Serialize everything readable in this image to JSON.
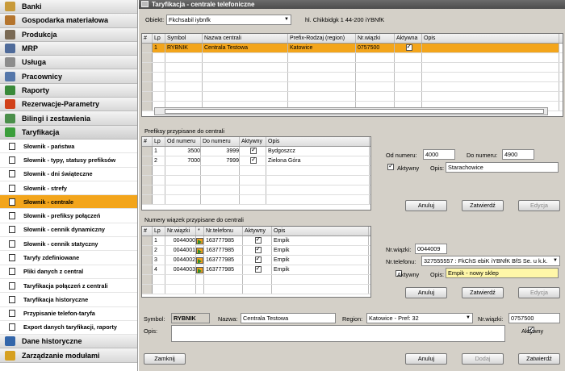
{
  "sidebar": {
    "modules_top": [
      {
        "label": "Banki",
        "icon": "bank-icon",
        "color": "#c89a3a"
      },
      {
        "label": "Gospodarka materiałowa",
        "icon": "boxes-icon",
        "color": "#b5752e"
      },
      {
        "label": "Produkcja",
        "icon": "gears-icon",
        "color": "#7a6a55"
      },
      {
        "label": "MRP",
        "icon": "mrp-icon",
        "color": "#4f6b9a"
      },
      {
        "label": "Usługa",
        "icon": "tools-icon",
        "color": "#8c8c8c"
      },
      {
        "label": "Pracownicy",
        "icon": "people-icon",
        "color": "#5577aa"
      },
      {
        "label": "Raporty",
        "icon": "report-icon",
        "color": "#3a8a3a"
      },
      {
        "label": "Rezerwacje-Parametry",
        "icon": "reservation-icon",
        "color": "#d1411a"
      },
      {
        "label": "Bilingi i zestawienia",
        "icon": "billing-icon",
        "color": "#4a8f4a"
      },
      {
        "label": "Taryfikacja",
        "icon": "tariff-icon",
        "color": "#3b9e3b"
      }
    ],
    "subitems": [
      "Słownik - państwa",
      "Słownik - typy, statusy prefiksów",
      "Słownik - dni świąteczne",
      "Słownik - strefy",
      "Słownik - centrale",
      "Słownik - prefiksy połączeń",
      "Słownik - cennik dynamiczny",
      "Słownik - cennik statyczny",
      "Taryfy zdefiniowane",
      "Pliki danych z central",
      "Taryfikacja połączeń z centrali",
      "Taryfikacja historyczne",
      "Przypisanie telefon-taryfa",
      "Export danych taryfikacji, raporty"
    ],
    "active_sub_index": 4,
    "modules_bottom": [
      {
        "label": "Dane historyczne",
        "icon": "history-icon",
        "color": "#3366aa"
      },
      {
        "label": "Zarządzanie modułami",
        "icon": "key-icon",
        "color": "#d6a020"
      }
    ]
  },
  "window": {
    "title": "Taryfikacja - centrale telefoniczne"
  },
  "top": {
    "obiekt_label": "Obiekt:",
    "obiekt_value": "Fkchsabil iybnfk",
    "address": "hl. Chikbidgk 1 44-200 iYBNfK"
  },
  "centrale_grid": {
    "headers": [
      "#",
      "Lp",
      "Symbol",
      "Nazwa centrali",
      "Prefix-Rodzaj (region)",
      "Nr.wiązki",
      "Aktywna",
      "Opis"
    ],
    "rows": [
      {
        "lp": "1",
        "symbol": "RYBNIK",
        "nazwa": "Centrala Testowa",
        "prefix": "Katowice",
        "wiazka": "0757500",
        "aktywna": true,
        "opis": ""
      }
    ]
  },
  "prefiksy": {
    "section_label": "Prefiksy przypisane do centrali",
    "headers": [
      "#",
      "Lp",
      "Od numeru",
      "Do numeru",
      "Aktywny",
      "Opis"
    ],
    "rows": [
      {
        "lp": "1",
        "od": "3500",
        "do": "3999",
        "aktywny": true,
        "opis": "Bydgoszcz"
      },
      {
        "lp": "2",
        "od": "7000",
        "do": "7999",
        "aktywny": true,
        "opis": "Zielona Góra"
      }
    ],
    "form": {
      "od_label": "Od numeru:",
      "od_value": "4000",
      "do_label": "Do numeru:",
      "do_value": "4900",
      "aktywny_label": "Aktywny",
      "aktywny": true,
      "opis_label": "Opis:",
      "opis_value": "Starachowice"
    },
    "buttons": {
      "anuluj": "Anuluj",
      "zatwierdz": "Zatwierdź",
      "edycja": "Edycja"
    }
  },
  "wiazki": {
    "section_label": "Numery wiązek przypisane do centrali",
    "headers": [
      "#",
      "Lp",
      "Nr.wiązki",
      "*",
      "Nr.telefonu",
      "Aktywny",
      "Opis"
    ],
    "rows": [
      {
        "lp": "1",
        "wiazka": "0044000",
        "tel": "163777985",
        "aktywny": true,
        "opis": "Empik"
      },
      {
        "lp": "2",
        "wiazka": "0044001",
        "tel": "163777985",
        "aktywny": true,
        "opis": "Empik"
      },
      {
        "lp": "3",
        "wiazka": "0044002",
        "tel": "163777985",
        "aktywny": true,
        "opis": "Empik"
      },
      {
        "lp": "4",
        "wiazka": "0044003",
        "tel": "163777985",
        "aktywny": true,
        "opis": "Empik"
      }
    ],
    "form": {
      "wiazka_label": "Nr.wiązki:",
      "wiazka_value": "0044009",
      "tel_label": "Nr.telefonu:",
      "tel_value": "327555557 : FkChS ebiK iYBNfK BfS Se. u k.k.",
      "aktywny_label": "Aktywny",
      "aktywny": false,
      "opis_label": "Opis:",
      "opis_value": "Empik - nowy sklep"
    },
    "buttons": {
      "anuluj": "Anuluj",
      "zatwierdz": "Zatwierdź",
      "edycja": "Edycja"
    }
  },
  "bottom": {
    "symbol_label": "Symbol:",
    "symbol_value": "RYBNIK",
    "nazwa_label": "Nazwa:",
    "nazwa_value": "Centrala Testowa",
    "region_label": "Region:",
    "region_value": "Katowice - Pref: 32",
    "wiazka_label": "Nr.wiązki:",
    "wiazka_value": "0757500",
    "opis_label": "Opis:",
    "opis_value": "",
    "aktywny_label": "Aktywny",
    "aktywny": true,
    "buttons": {
      "zamknij": "Zamknij",
      "anuluj": "Anuluj",
      "dodaj": "Dodaj",
      "zatwierdz": "Zatwierdź"
    }
  }
}
